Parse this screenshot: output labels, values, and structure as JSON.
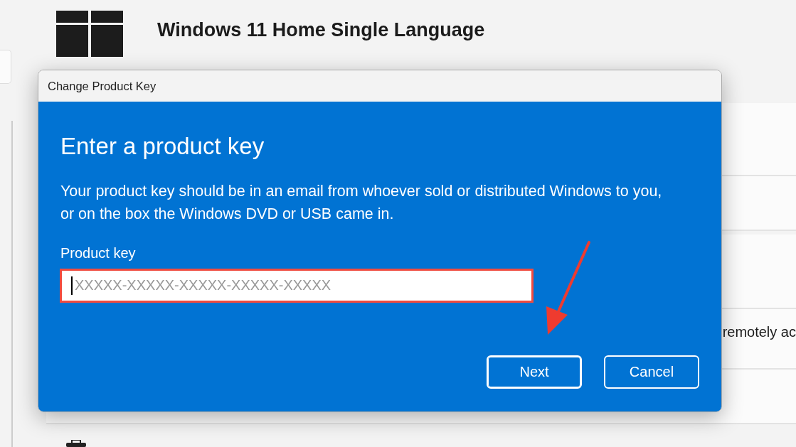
{
  "edition": {
    "title": "Windows 11 Home Single Language"
  },
  "setting_row": {
    "text": "remotely ac"
  },
  "dialog": {
    "title": "Change Product Key",
    "heading": "Enter a product key",
    "description": "Your product key should be in an email from whoever sold or distributed Windows to you, or on the box the Windows DVD or USB came in.",
    "field": {
      "label": "Product key",
      "placeholder": "XXXXX-XXXXX-XXXXX-XXXXX-XXXXX",
      "focused": true,
      "highlighted": true
    },
    "buttons": [
      {
        "label": "Next",
        "kind": "primary"
      },
      {
        "label": "Cancel",
        "kind": "secondary"
      }
    ]
  }
}
